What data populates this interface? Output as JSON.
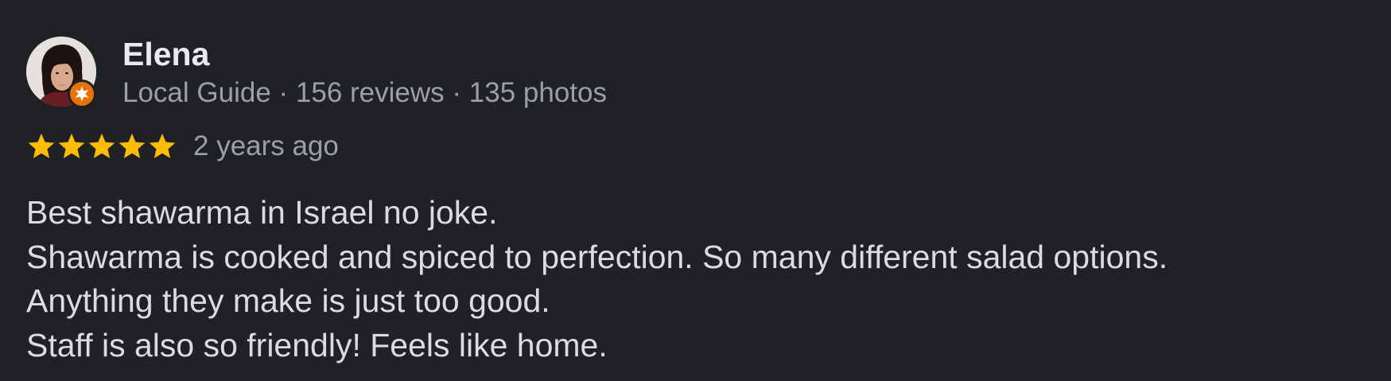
{
  "review": {
    "author": {
      "name": "Elena",
      "badge_icon": "local-guide-star-icon",
      "meta": {
        "level": "Local Guide",
        "separator": " · ",
        "reviews": "156 reviews",
        "photos": "135 photos"
      }
    },
    "rating": {
      "stars": 5,
      "max": 5,
      "star_color": "#fbbc04"
    },
    "time": "2 years ago",
    "text_lines": [
      "Best shawarma in Israel no joke.",
      "Shawarma is cooked and spiced to perfection. So many different salad options.",
      "Anything they make is just too good.",
      "Staff is also so friendly! Feels like home."
    ]
  },
  "colors": {
    "background": "#202124",
    "primary_text": "#e8eaed",
    "secondary_text": "#9aa0a6",
    "body_text": "#dadce0",
    "badge": "#e8710a"
  }
}
